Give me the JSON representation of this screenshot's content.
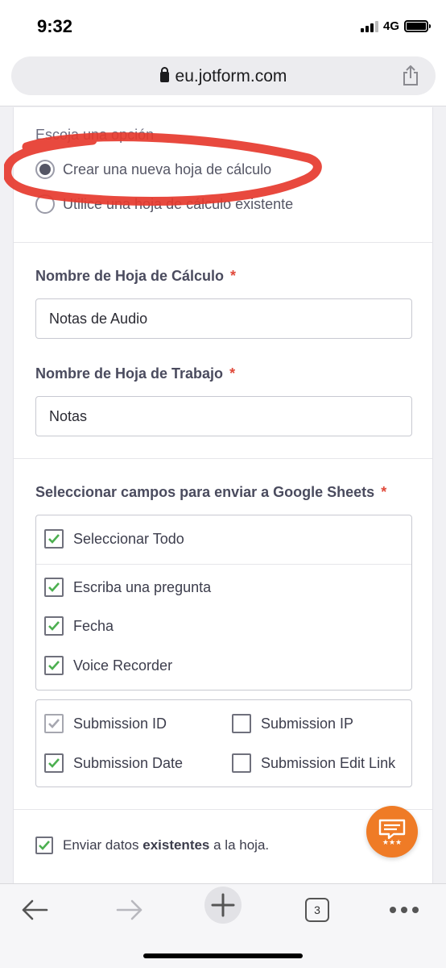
{
  "status": {
    "time": "9:32",
    "network": "4G"
  },
  "browser": {
    "url": "eu.jotform.com",
    "tab_count": "3"
  },
  "form": {
    "option_label": "Escoja una opción",
    "options": [
      "Crear una nueva hoja de cálculo",
      "Utilice una hoja de cálculo existente"
    ],
    "spreadsheet_name_label": "Nombre de Hoja de Cálculo",
    "spreadsheet_name_value": "Notas de Audio",
    "worksheet_name_label": "Nombre de Hoja de Trabajo",
    "worksheet_name_value": "Notas",
    "required_mark": "*",
    "fields_label": "Seleccionar campos para enviar a Google Sheets",
    "select_all": "Seleccionar Todo",
    "fields": [
      "Escriba una pregunta",
      "Fecha",
      "Voice Recorder"
    ],
    "meta_fields": {
      "submission_id": "Submission ID",
      "submission_ip": "Submission IP",
      "submission_date": "Submission Date",
      "submission_edit_link": "Submission Edit Link"
    },
    "send_existing": {
      "before": "Enviar datos ",
      "bold": "existentes",
      "after": " a la hoja."
    }
  },
  "colors": {
    "accent_orange": "#ef7b26",
    "check_green": "#4caf50",
    "annotation_red": "#e63a2e",
    "required_red": "#e0493a"
  }
}
